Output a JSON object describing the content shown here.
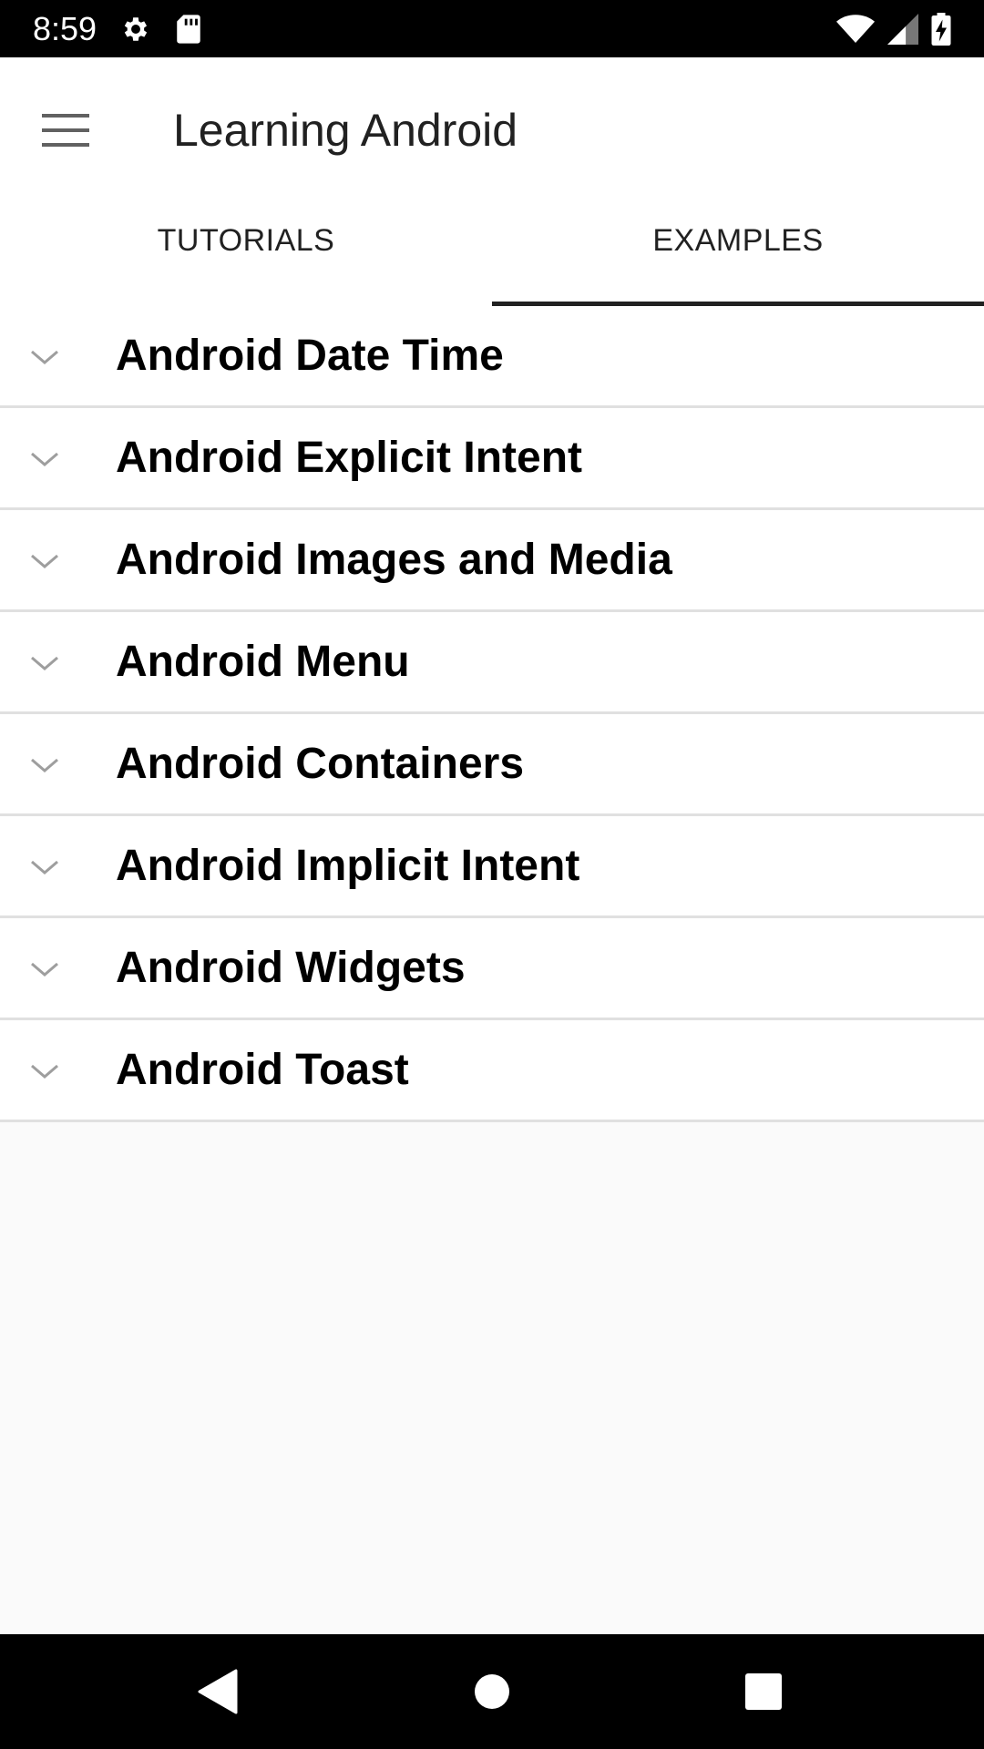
{
  "status_bar": {
    "time": "8:59",
    "icons": [
      "settings-icon",
      "sd-card-icon",
      "wifi-icon",
      "cell-signal-icon",
      "battery-charging-icon"
    ]
  },
  "app_bar": {
    "menu_icon": "hamburger-menu-icon",
    "title": "Learning Android"
  },
  "tabs": [
    {
      "label": "TUTORIALS",
      "active": false
    },
    {
      "label": "EXAMPLES",
      "active": true
    }
  ],
  "list": {
    "expand_icon": "chevron-down-icon",
    "items": [
      {
        "label": "Android Date Time"
      },
      {
        "label": "Android Explicit Intent"
      },
      {
        "label": "Android Images and Media"
      },
      {
        "label": "Android Menu"
      },
      {
        "label": "Android Containers"
      },
      {
        "label": "Android Implicit Intent"
      },
      {
        "label": "Android Widgets"
      },
      {
        "label": "Android Toast"
      }
    ]
  },
  "nav_bar": {
    "buttons": [
      "back-icon",
      "home-icon",
      "recents-icon"
    ]
  },
  "colors": {
    "status_bar": "#000000",
    "nav_bar": "#000000",
    "app_bar": "#ffffff",
    "tab_indicator": "#212121",
    "background": "#fafafa",
    "divider": "#e0e0e0",
    "chevron": "#9e9e9e"
  }
}
